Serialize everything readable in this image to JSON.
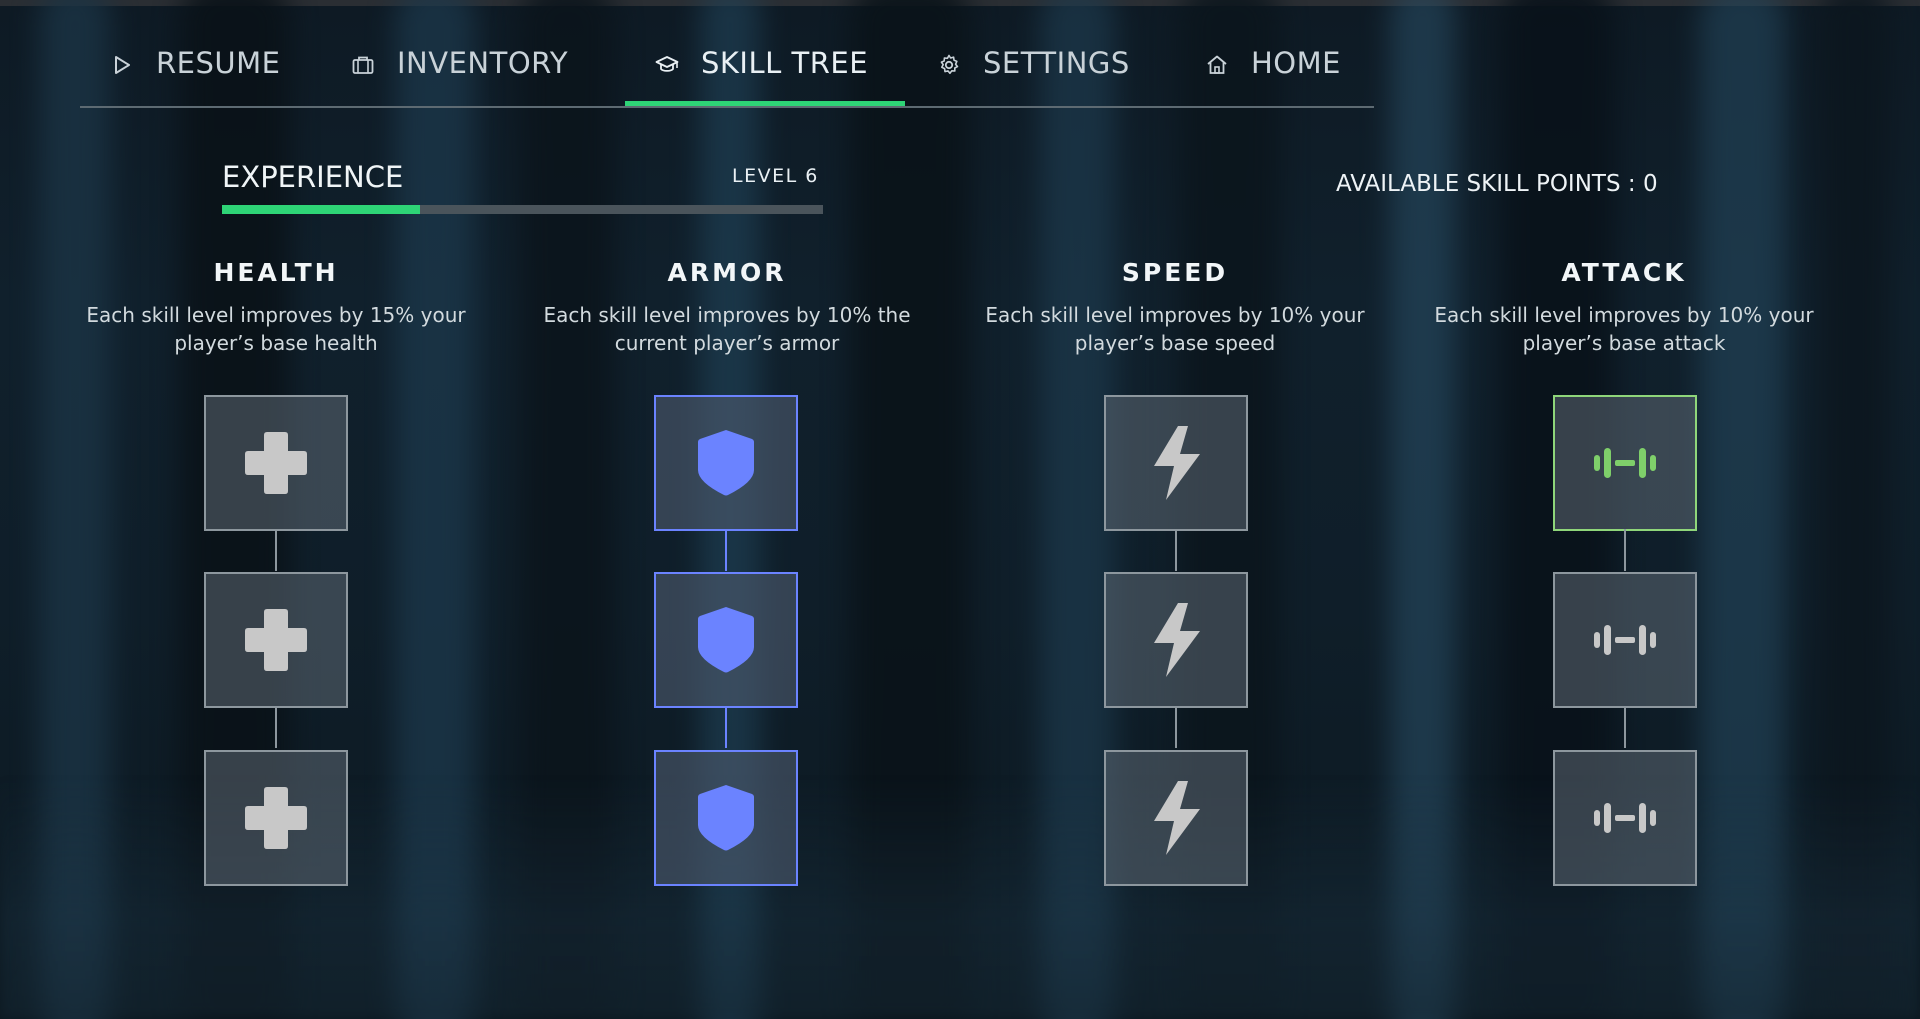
{
  "nav": {
    "tabs": [
      {
        "id": "resume",
        "label": "RESUME",
        "icon": "play-icon"
      },
      {
        "id": "inventory",
        "label": "INVENTORY",
        "icon": "briefcase-icon"
      },
      {
        "id": "skill_tree",
        "label": "SKILL TREE",
        "icon": "graduation-cap-icon",
        "active": true
      },
      {
        "id": "settings",
        "label": "SETTINGS",
        "icon": "gear-icon"
      },
      {
        "id": "home",
        "label": "HOME",
        "icon": "house-icon"
      }
    ],
    "accent": "#2ed476"
  },
  "experience": {
    "title": "EXPERIENCE",
    "level_label": "LEVEL 6",
    "progress": 0.33,
    "bar_color": "#2ed476"
  },
  "skill_points": {
    "label": "AVAILABLE SKILL POINTS : 0"
  },
  "skills": [
    {
      "id": "health",
      "title": "HEALTH",
      "description": "Each skill level improves by 15% your player’s base health",
      "icon": "plus-icon",
      "levels_unlocked": 0,
      "color": "#c8c8c8"
    },
    {
      "id": "armor",
      "title": "ARMOR",
      "description": "Each skill level improves by 10% the current player’s armor",
      "icon": "shield-icon",
      "levels_unlocked": 3,
      "color": "#6b83ff"
    },
    {
      "id": "speed",
      "title": "SPEED",
      "description": "Each skill level improves by 10% your player’s base speed",
      "icon": "lightning-icon",
      "levels_unlocked": 0,
      "color": "#c8c8c8"
    },
    {
      "id": "attack",
      "title": "ATTACK",
      "description": "Each skill level improves by 10% your player’s base attack",
      "icon": "dumbbell-icon",
      "levels_unlocked": 0,
      "selected_level": 1,
      "color": "#7fcf6a"
    }
  ]
}
